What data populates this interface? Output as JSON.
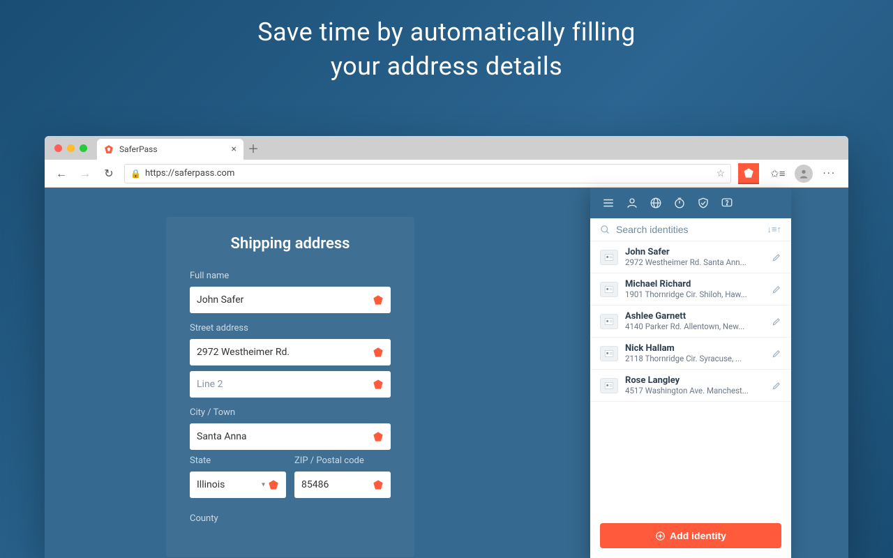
{
  "hero": {
    "line1": "Save time by automatically filling",
    "line2": "your address details"
  },
  "browser": {
    "tab_title": "SaferPass",
    "url": "https://saferpass.com"
  },
  "form": {
    "title": "Shipping address",
    "fullname_label": "Full name",
    "fullname_value": "John Safer",
    "street_label": "Street address",
    "street_value": "2972 Westheimer Rd.",
    "line2_placeholder": "Line 2",
    "city_label": "City / Town",
    "city_value": "Santa Anna",
    "state_label": "State",
    "state_value": "Illinois",
    "zip_label": "ZIP / Postal code",
    "zip_value": "85486",
    "county_label": "County"
  },
  "popup": {
    "search_placeholder": "Search identities",
    "add_label": "Add identity",
    "identities": [
      {
        "name": "John Safer",
        "addr": "2972 Westheimer Rd. Santa Ann..."
      },
      {
        "name": "Michael Richard",
        "addr": "1901 Thornridge Cir. Shiloh, Haw..."
      },
      {
        "name": "Ashlee Garnett",
        "addr": "4140 Parker Rd. Allentown, New..."
      },
      {
        "name": "Nick Hallam",
        "addr": "2118 Thornridge Cir. Syracuse, ..."
      },
      {
        "name": "Rose Langley",
        "addr": "4517 Washington Ave. Manchest..."
      }
    ]
  }
}
